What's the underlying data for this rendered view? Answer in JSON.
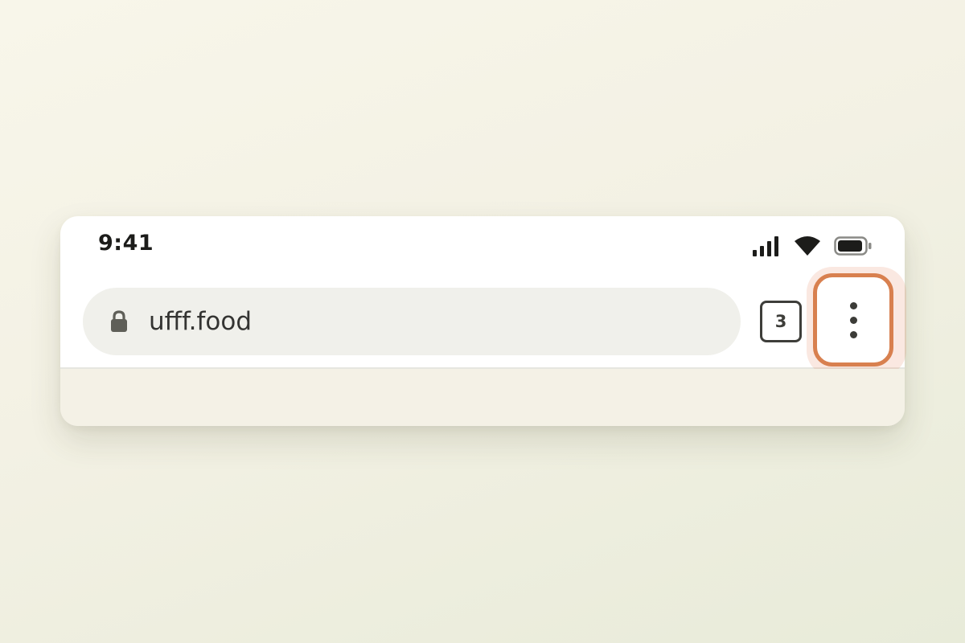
{
  "status_bar": {
    "time": "9:41",
    "icons": [
      "signal-icon",
      "wifi-icon",
      "battery-icon"
    ]
  },
  "address_bar": {
    "url": "ufff.food",
    "icon": "lock-icon"
  },
  "toolbar": {
    "tab_count": "3",
    "menu_icon": "more-vertical-icon",
    "menu_highlight_color": "#d8804f"
  },
  "colors": {
    "background": "#f5f3e6",
    "url_bar": "#f0f0eb",
    "text": "#343432"
  }
}
